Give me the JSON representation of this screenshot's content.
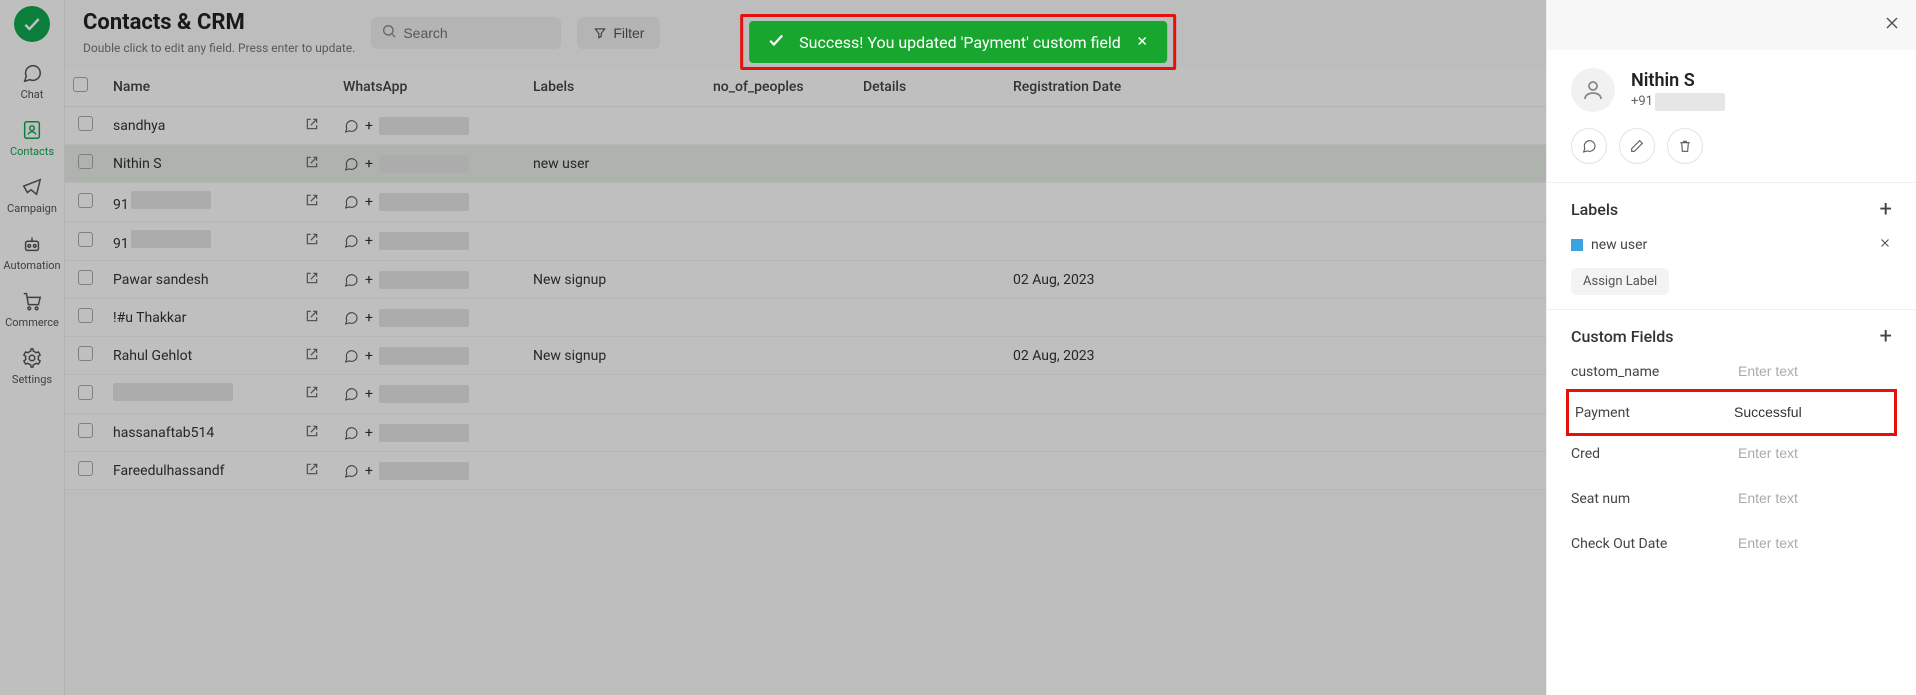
{
  "nav": {
    "items": [
      {
        "label": "Chat"
      },
      {
        "label": "Contacts"
      },
      {
        "label": "Campaign"
      },
      {
        "label": "Automation"
      },
      {
        "label": "Commerce"
      },
      {
        "label": "Settings"
      }
    ]
  },
  "header": {
    "title": "Contacts & CRM",
    "subtitle": "Double click to edit any field. Press enter to update.",
    "search_placeholder": "Search",
    "filter_label": "Filter"
  },
  "toast": {
    "message": "Success! You updated 'Payment' custom field"
  },
  "table": {
    "columns": [
      "Name",
      "WhatsApp",
      "Labels",
      "no_of_peoples",
      "Details",
      "Registration Date"
    ],
    "rows": [
      {
        "name": "sandhya",
        "wa_prefix": "+",
        "labels": "",
        "no": "",
        "details": "",
        "reg": "",
        "selected": false
      },
      {
        "name": "Nithin S",
        "wa_prefix": "+",
        "labels": "new user",
        "no": "",
        "details": "",
        "reg": "",
        "selected": true
      },
      {
        "name": "91",
        "wa_prefix": "+",
        "labels": "",
        "no": "",
        "details": "",
        "reg": "",
        "selected": false,
        "name_redacted": true
      },
      {
        "name": "91",
        "wa_prefix": "+",
        "labels": "",
        "no": "",
        "details": "",
        "reg": "",
        "selected": false,
        "name_redacted": true
      },
      {
        "name": "Pawar sandesh",
        "wa_prefix": "+",
        "labels": "New signup",
        "no": "",
        "details": "",
        "reg": "02 Aug, 2023",
        "selected": false
      },
      {
        "name": "!#u Thakkar",
        "wa_prefix": "+",
        "labels": "",
        "no": "",
        "details": "",
        "reg": "",
        "selected": false
      },
      {
        "name": "Rahul Gehlot",
        "wa_prefix": "+",
        "labels": "New signup",
        "no": "",
        "details": "",
        "reg": "02 Aug, 2023",
        "selected": false
      },
      {
        "name": "",
        "wa_prefix": "+",
        "labels": "",
        "no": "",
        "details": "",
        "reg": "",
        "selected": false,
        "full_redacted": true
      },
      {
        "name": "hassanaftab514",
        "wa_prefix": "+",
        "labels": "",
        "no": "",
        "details": "",
        "reg": "",
        "selected": false
      },
      {
        "name": "Fareedulhassandf",
        "wa_prefix": "+",
        "labels": "",
        "no": "",
        "details": "",
        "reg": "",
        "selected": false
      }
    ]
  },
  "detail": {
    "name": "Nithin S",
    "phone_prefix": "+91",
    "labels_title": "Labels",
    "label_chip": "new user",
    "assign_label": "Assign Label",
    "custom_fields_title": "Custom Fields",
    "fields": [
      {
        "name": "custom_name",
        "value": "",
        "placeholder": "Enter text"
      },
      {
        "name": "Payment",
        "value": "Successful",
        "placeholder": "Enter text",
        "highlight": true
      },
      {
        "name": "Cred",
        "value": "",
        "placeholder": "Enter text"
      },
      {
        "name": "Seat num",
        "value": "",
        "placeholder": "Enter text"
      },
      {
        "name": "Check Out Date",
        "value": "",
        "placeholder": "Enter text"
      }
    ]
  }
}
